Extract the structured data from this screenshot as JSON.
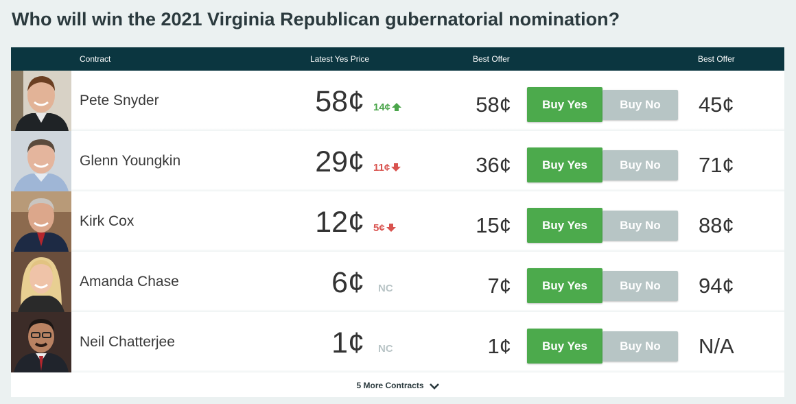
{
  "page": {
    "title": "Who will win the 2021 Virginia Republican gubernatorial nomination?"
  },
  "table": {
    "headers": {
      "contract": "Contract",
      "latest_yes_price": "Latest Yes Price",
      "best_offer_yes": "Best Offer",
      "best_offer_no": "Best Offer"
    },
    "rows": [
      {
        "name": "Pete Snyder",
        "price": "58¢",
        "change": "14¢",
        "direction": "up",
        "best_offer_yes": "58¢",
        "buy_yes": "Buy Yes",
        "buy_no": "Buy No",
        "best_offer_no": "45¢"
      },
      {
        "name": "Glenn Youngkin",
        "price": "29¢",
        "change": "11¢",
        "direction": "down",
        "best_offer_yes": "36¢",
        "buy_yes": "Buy Yes",
        "buy_no": "Buy No",
        "best_offer_no": "71¢"
      },
      {
        "name": "Kirk Cox",
        "price": "12¢",
        "change": "5¢",
        "direction": "down",
        "best_offer_yes": "15¢",
        "buy_yes": "Buy Yes",
        "buy_no": "Buy No",
        "best_offer_no": "88¢"
      },
      {
        "name": "Amanda Chase",
        "price": "6¢",
        "change": "NC",
        "direction": "none",
        "best_offer_yes": "7¢",
        "buy_yes": "Buy Yes",
        "buy_no": "Buy No",
        "best_offer_no": "94¢"
      },
      {
        "name": "Neil Chatterjee",
        "price": "1¢",
        "change": "NC",
        "direction": "none",
        "best_offer_yes": "1¢",
        "buy_yes": "Buy Yes",
        "buy_no": "Buy No",
        "best_offer_no": "N/A"
      }
    ],
    "more_contracts": "5 More Contracts"
  },
  "colors": {
    "header_bg": "#0b3640",
    "buy_yes": "#4caa4c",
    "buy_no": "#b7c5c5",
    "up": "#4aa54a",
    "down": "#d9534f",
    "page_bg": "#ebf1f1"
  },
  "icons": {
    "up": "arrow-up-icon",
    "down": "arrow-down-icon",
    "more": "chevron-down-icon"
  }
}
